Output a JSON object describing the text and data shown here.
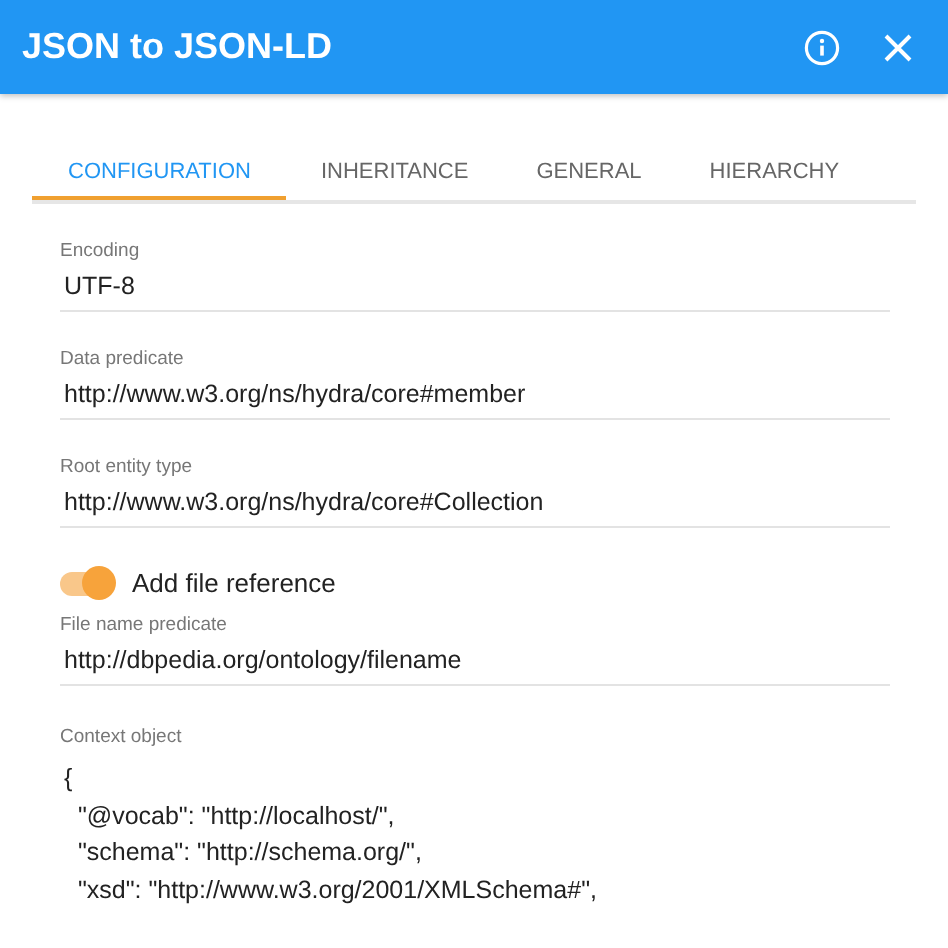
{
  "window": {
    "title": "JSON to JSON-LD"
  },
  "tabs": [
    {
      "label": "CONFIGURATION",
      "selected": true
    },
    {
      "label": "INHERITANCE",
      "selected": false
    },
    {
      "label": "GENERAL",
      "selected": false
    },
    {
      "label": "HIERARCHY",
      "selected": false
    }
  ],
  "fields": [
    {
      "label": "Encoding",
      "value": "UTF-8"
    },
    {
      "label": "Data predicate",
      "value": "http://www.w3.org/ns/hydra/core#member"
    },
    {
      "label": "Root entity type",
      "value": "http://www.w3.org/ns/hydra/core#Collection"
    }
  ],
  "toggle": {
    "label": "Add file reference",
    "on": true
  },
  "file_field": {
    "label": "File name predicate",
    "value": "http://dbpedia.org/ontology/filename"
  },
  "context_object": {
    "label": "Context object",
    "lines": [
      "{",
      "  \"@vocab\": \"http://localhost/\",",
      "  \"schema\": \"http://schema.org/\",",
      "  \"xsd\": \"http://www.w3.org/2001/XMLSchema#\","
    ]
  }
}
